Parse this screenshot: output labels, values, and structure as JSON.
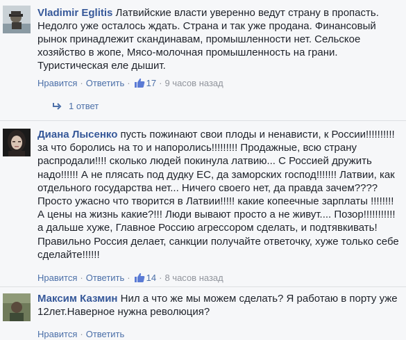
{
  "comments": [
    {
      "author": "Vladimir Eglitis",
      "text": "Латвийские власти уверенно ведут страну в пропасть. Недолго уже осталось ждать. Страна и так уже продана. Финансовый рынок принадлежит скандинавам, промышленности нет. Сельское хозяйство в жопе, Мясо-молочная промышленность на грани. Туристическая еле дышит.",
      "like_label": "Нравится",
      "reply_label": "Ответить",
      "like_count": "17",
      "time": "9 часов назад",
      "replies_label": "1 ответ"
    },
    {
      "author": "Диана Лысенко",
      "text": "пусть пожинают свои плоды и ненависти, к России!!!!!!!!!! за что боролись на то и напоролись!!!!!!!!! Продажные, всю страну распродали!!!! сколько людей покинула латвию... С Россией дружить надо!!!!!! А не плясать под дудку ЕС, да заморских господ!!!!!!! Латвии, как отдельного государства нет... Ничего своего нет, да правда зачем???? Просто ужасно что творится в Латвии!!!!! какие копеечные зарплаты !!!!!!!! А цены на жизнь какие?!!! Люди вывают просто а не живут.... Позор!!!!!!!!!!! а дальше хуже, Главное Россию агрессором сделать, и подтявкивать! Правильно Россия делает, санкции получайте ответочку, хуже только себе сделайте!!!!!!",
      "like_label": "Нравится",
      "reply_label": "Ответить",
      "like_count": "14",
      "time": "8 часов назад"
    },
    {
      "author": "Максим Казмин",
      "text": "Нил а что же мы можем сделать? Я работаю в порту уже 12лет.Наверное нужна революция?",
      "like_label": "Нравится",
      "reply_label": "Ответить"
    }
  ],
  "colors": {
    "author": "#365899",
    "link": "#4b6fa8",
    "meta": "#90949c",
    "background": "#f6f7f9"
  }
}
